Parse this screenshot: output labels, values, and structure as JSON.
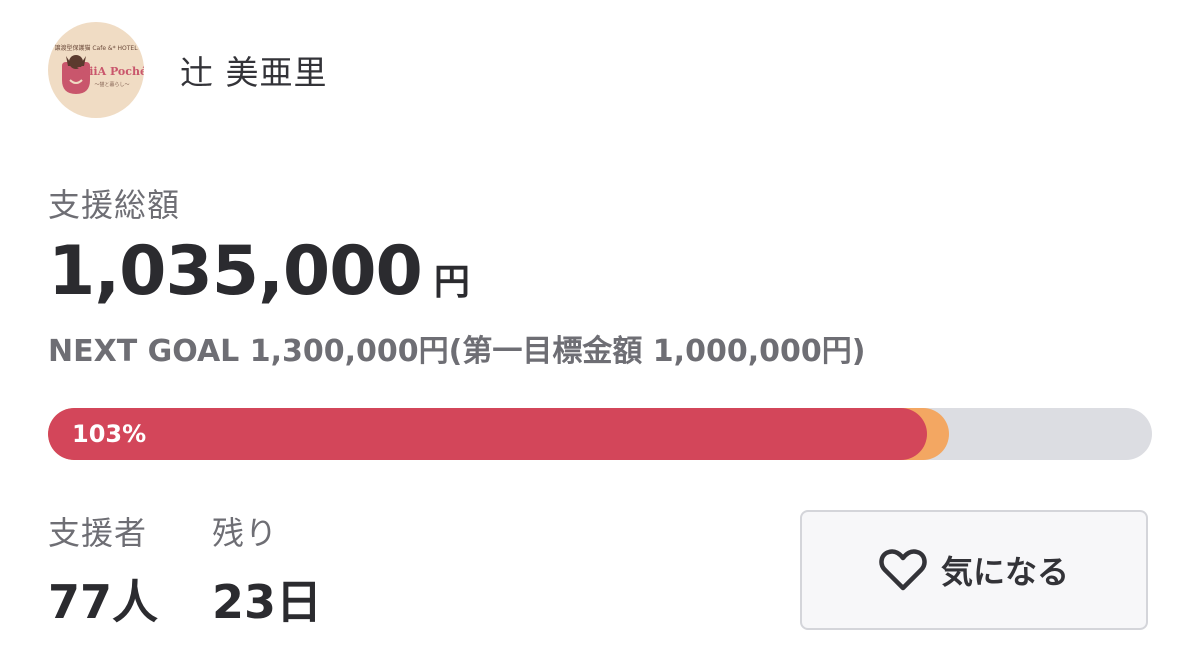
{
  "owner": {
    "name": "辻 美亜里",
    "logo": {
      "tagline": "譲渡型保護猫 Cafe &* HOTEL",
      "brand": "MiiA Poché",
      "sub": "〜猫と暮らし〜"
    }
  },
  "funding": {
    "total_label": "支援総額",
    "total_amount": "1,035,000",
    "currency_unit": "円",
    "next_goal_text": "NEXT GOAL 1,300,000円(第一目標金額 1,000,000円)",
    "progress_label": "103%",
    "progress_fraction_of_next_goal": 0.796
  },
  "stats": {
    "supporters_label": "支援者",
    "supporters_value": "77人",
    "remaining_label": "残り",
    "remaining_value": "23日"
  },
  "favorite_button": {
    "label": "気になる",
    "icon": "heart-outline-icon"
  },
  "colors": {
    "progress_fill": "#d3465a",
    "progress_goal_marker": "#f3a762",
    "progress_track": "#dcdde2",
    "avatar_bg": "#f0dcc4"
  }
}
